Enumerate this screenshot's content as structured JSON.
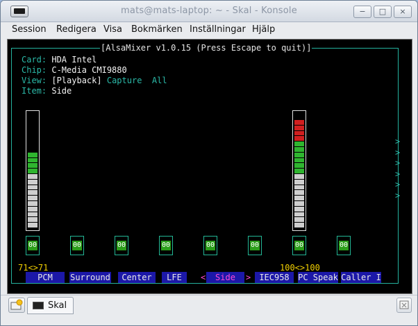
{
  "window": {
    "title": "mats@mats-laptop: ~ - Skal - Konsole",
    "buttons": {
      "minimize": "−",
      "maximize": "□",
      "close": "×"
    }
  },
  "menu": [
    "Session",
    "Redigera",
    "Visa",
    "Bokmärken",
    "Inställningar",
    "Hjälp"
  ],
  "alsamixer": {
    "frame_title": "[AlsaMixer v1.0.15 (Press Escape to quit)]",
    "card_label": "Card:",
    "card": "HDA Intel",
    "chip_label": "Chip:",
    "chip": "C-Media CMI9880",
    "view_label": "View:",
    "view_playback": "[Playback]",
    "view_capture": "Capture",
    "view_all": "All",
    "item_label": "Item:",
    "item": "Side",
    "scroll_arrows": [
      ">",
      ">",
      ">",
      ">",
      ">",
      ">"
    ],
    "sel_left": "<",
    "sel_right": ">",
    "channels": [
      {
        "name": "PCM",
        "mute": "00",
        "volume_text": "71<>71",
        "level": 71,
        "has_bar": true,
        "selected": false
      },
      {
        "name": "Surround",
        "mute": "00",
        "has_bar": false,
        "selected": false
      },
      {
        "name": "Center",
        "mute": "00",
        "has_bar": false,
        "selected": false
      },
      {
        "name": "LFE",
        "mute": "00",
        "has_bar": false,
        "selected": false
      },
      {
        "name": "Side",
        "mute": "00",
        "has_bar": false,
        "selected": true
      },
      {
        "name": "IEC958",
        "mute": "00",
        "has_bar": false,
        "selected": false
      },
      {
        "name": "PC Speak",
        "mute": "00",
        "volume_text": "100<>100",
        "level": 100,
        "has_bar": true,
        "selected": false
      },
      {
        "name": "Caller I",
        "mute": "00",
        "has_bar": false,
        "selected": false
      }
    ]
  },
  "tabbar": {
    "tab_label": "Skal"
  },
  "colors": {
    "terminal_bg": "#000000",
    "frame": "#25b39f",
    "channel_bg": "#1c18a8",
    "selected": "#ff49d6",
    "volume": "#f2d000",
    "bar_low": "#cfcfcf",
    "bar_mid": "#2fb52f",
    "bar_high": "#d11f1f"
  }
}
